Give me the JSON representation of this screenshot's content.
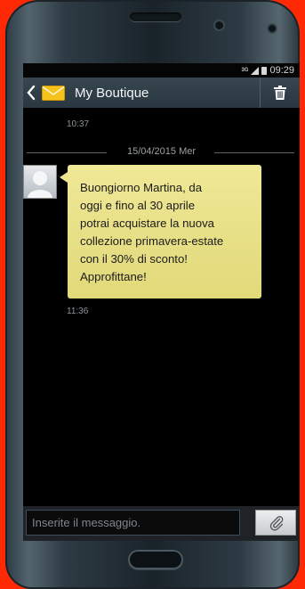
{
  "status_bar": {
    "network": "3G",
    "time": "09:29"
  },
  "app_bar": {
    "title": "My Boutique"
  },
  "conversation": {
    "earlier_time": "10:37",
    "date_separator": "15/04/2015 Mer",
    "message": {
      "lines": [
        "Buongiorno Martina, da",
        "oggi e fino al 30 aprile",
        "potrai acquistare la nuova",
        "collezione primavera-estate",
        "con il 30% di sconto!",
        "Approfittane!"
      ],
      "time": "11:36"
    }
  },
  "composer": {
    "placeholder": "Inserite il messaggio."
  },
  "colors": {
    "background": "#ff2a05",
    "bubble": "#e9e188",
    "app_bar": "#2f3d46"
  },
  "icons": [
    "back-icon",
    "message-envelope-icon",
    "trash-icon",
    "paperclip-icon",
    "signal-icon",
    "battery-icon"
  ]
}
